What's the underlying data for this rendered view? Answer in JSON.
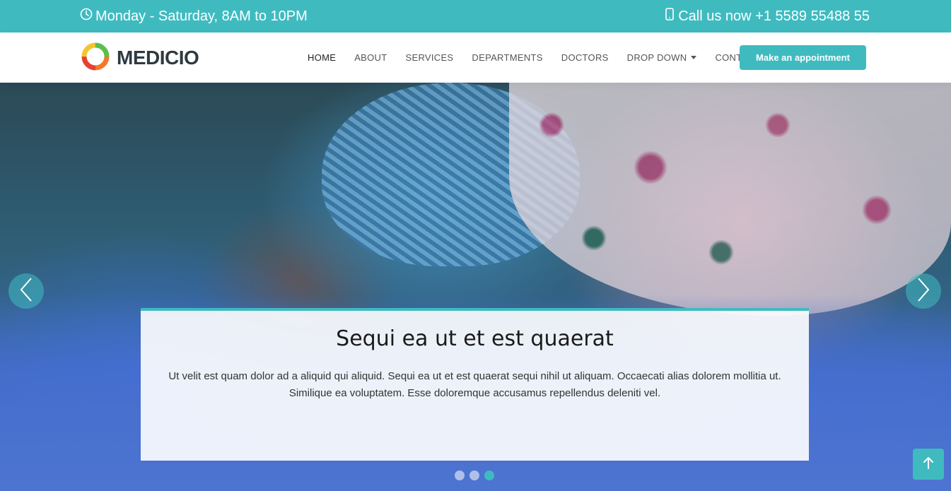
{
  "topbar": {
    "hours": "Monday - Saturday, 8AM to 10PM",
    "phone": "Call us now +1 5589 55488 55",
    "hours_icon": "clock-icon",
    "phone_icon": "phone-icon"
  },
  "brand": {
    "name": "MEDICIO",
    "logo_icon": "ring-logo-icon"
  },
  "nav": {
    "items": [
      {
        "label": "HOME"
      },
      {
        "label": "ABOUT"
      },
      {
        "label": "SERVICES"
      },
      {
        "label": "DEPARTMENTS"
      },
      {
        "label": "DOCTORS"
      },
      {
        "label": "DROP DOWN"
      },
      {
        "label": "CONTACT"
      }
    ],
    "active": "HOME",
    "appointment_button": "Make an appointment"
  },
  "hero": {
    "title": "Sequi ea ut et est quaerat",
    "text": "Ut velit est quam dolor ad a aliquid qui aliquid. Sequi ea ut et est quaerat sequi nihil ut aliquam. Occaecati alias dolorem mollitia ut. Similique ea voluptatem. Esse doloremque accusamus repellendus deleniti vel.",
    "slide_count": 3,
    "active_slide": 3,
    "prev_icon": "chevron-left-icon",
    "next_icon": "chevron-right-icon"
  },
  "colors": {
    "accent": "#3fbbc0",
    "text_dark": "#2f3a40"
  },
  "back_to_top_icon": "arrow-up-icon"
}
